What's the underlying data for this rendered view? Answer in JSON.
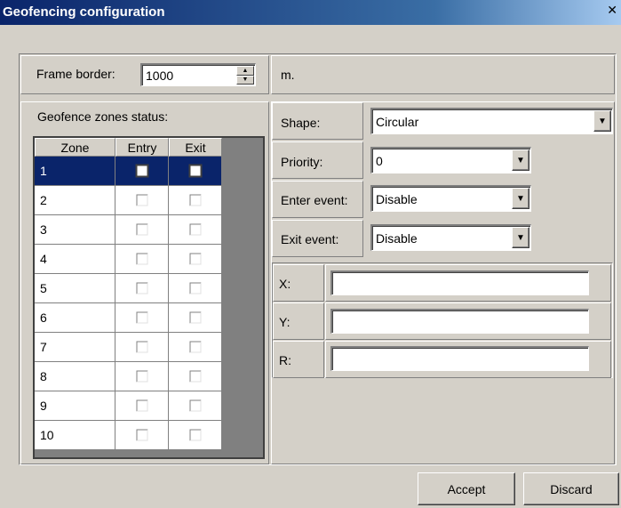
{
  "window": {
    "title": "Geofencing configuration",
    "close_glyph": "✕"
  },
  "frame": {
    "label": "Frame border:",
    "value": "1000",
    "unit": "m."
  },
  "zones": {
    "title": "Geofence zones status:",
    "headers": [
      "Zone",
      "Entry",
      "Exit"
    ],
    "rows": [
      "1",
      "2",
      "3",
      "4",
      "5",
      "6",
      "7",
      "8",
      "9",
      "10"
    ],
    "selected_row": 0
  },
  "shape": {
    "label": "Shape:",
    "value": "Circular"
  },
  "priority": {
    "label": "Priority:",
    "value": "0"
  },
  "enter_event": {
    "label": "Enter event:",
    "value": "Disable"
  },
  "exit_event": {
    "label": "Exit event:",
    "value": "Disable"
  },
  "coords": {
    "x_label": "X:",
    "y_label": "Y:",
    "r_label": "R:",
    "x": "",
    "y": "",
    "r": ""
  },
  "buttons": {
    "accept": "Accept",
    "discard": "Discard"
  },
  "colors": {
    "title_bar": "#0a246a",
    "selection": "#0a246a",
    "face": "#d4d0c8"
  }
}
